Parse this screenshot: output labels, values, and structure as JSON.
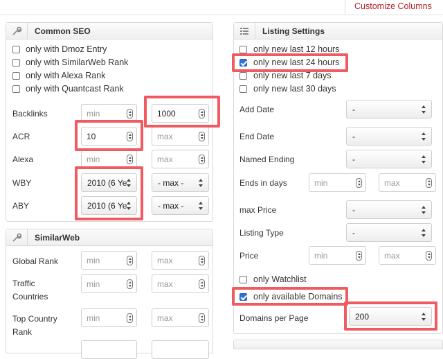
{
  "topbar": {
    "customize_label": "Customize Columns"
  },
  "common_seo": {
    "title": "Common SEO",
    "icon": "wrench-icon",
    "checkboxes": [
      {
        "label": "only with Dmoz Entry",
        "checked": false
      },
      {
        "label": "only with SimilarWeb Rank",
        "checked": false
      },
      {
        "label": "only with Alexa Rank",
        "checked": false
      },
      {
        "label": "only with Quantcast Rank",
        "checked": false
      }
    ],
    "rows": [
      {
        "label": "Backlinks",
        "min": {
          "placeholder": "min",
          "value": ""
        },
        "max": {
          "placeholder": "max",
          "value": "1000"
        }
      },
      {
        "label": "ACR",
        "min": {
          "placeholder": "min",
          "value": "10"
        },
        "max": {
          "placeholder": "max",
          "value": ""
        }
      },
      {
        "label": "Alexa",
        "min": {
          "placeholder": "min",
          "value": ""
        },
        "max": {
          "placeholder": "max",
          "value": ""
        }
      },
      {
        "label": "WBY",
        "min_select": "2010 (6 Ye",
        "max_select": "- max -"
      },
      {
        "label": "ABY",
        "min_select": "2010 (6 Ye",
        "max_select": "- max -"
      }
    ]
  },
  "similarweb": {
    "title": "SimilarWeb",
    "icon": "wrench-icon",
    "rows": [
      {
        "label": "Global Rank",
        "min": "min",
        "max": "max"
      },
      {
        "label": "Traffic Countries",
        "min": "min",
        "max": "max"
      },
      {
        "label": "Top Country Rank",
        "min": "min",
        "max": "max"
      }
    ]
  },
  "listing": {
    "title": "Listing Settings",
    "icon": "list-icon",
    "checkboxes": [
      {
        "label": "only new last 12 hours",
        "checked": false
      },
      {
        "label": "only new last 24 hours",
        "checked": true
      },
      {
        "label": "only new last 7 days",
        "checked": false
      },
      {
        "label": "only new last 30 days",
        "checked": false
      }
    ],
    "selects": [
      {
        "label": "Add Date",
        "value": "-"
      },
      {
        "label": "End Date",
        "value": "-"
      },
      {
        "label": "Named Ending",
        "value": "-"
      }
    ],
    "ends_in_days": {
      "label": "Ends in days",
      "min": "min",
      "max": "max"
    },
    "selects2": [
      {
        "label": "max Price",
        "value": "-"
      },
      {
        "label": "Listing Type",
        "value": "-"
      }
    ],
    "price": {
      "label": "Price",
      "min": "min",
      "max": "max"
    },
    "watchlist": {
      "label": "only Watchlist",
      "checked": false
    },
    "available": {
      "label": "only available Domains",
      "checked": true
    },
    "domains_per_page": {
      "label": "Domains per Page",
      "value": "200"
    }
  },
  "colors": {
    "highlight": "#ef5b60",
    "accent": "#b52027",
    "checkbox": "#2a72d8"
  }
}
